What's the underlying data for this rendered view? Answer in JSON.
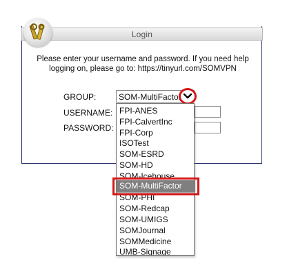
{
  "header": {
    "title": "Login"
  },
  "intro": "Please enter your username and password. If you need help logging on, please go to: https://tinyurl.com/SOMVPN",
  "form": {
    "group_label": "GROUP:",
    "username_label": "USERNAME:",
    "password_label": "PASSWORD:",
    "group_selected": "SOM-MultiFactor",
    "username_value": "",
    "password_value": ""
  },
  "dropdown": {
    "options": [
      "FPI-ANES",
      "FPI-CalvertInc",
      "FPI-Corp",
      "ISOTest",
      "SOM-ESRD",
      "SOM-HD",
      "SOM-Icehouse",
      "SOM-MultiFactor",
      "SOM-PHI",
      "SOM-Redcap",
      "SOM-UMIGS",
      "SOMJournal",
      "SOMMedicine",
      "UMB-Signage"
    ],
    "selected_index": 7
  },
  "colors": {
    "highlight": "#d41717",
    "selected_bg": "#808080",
    "card_border": "#1f2a6b"
  },
  "icons": {
    "logo": "tools-badge-icon",
    "dropdown": "chevron-down-icon"
  }
}
